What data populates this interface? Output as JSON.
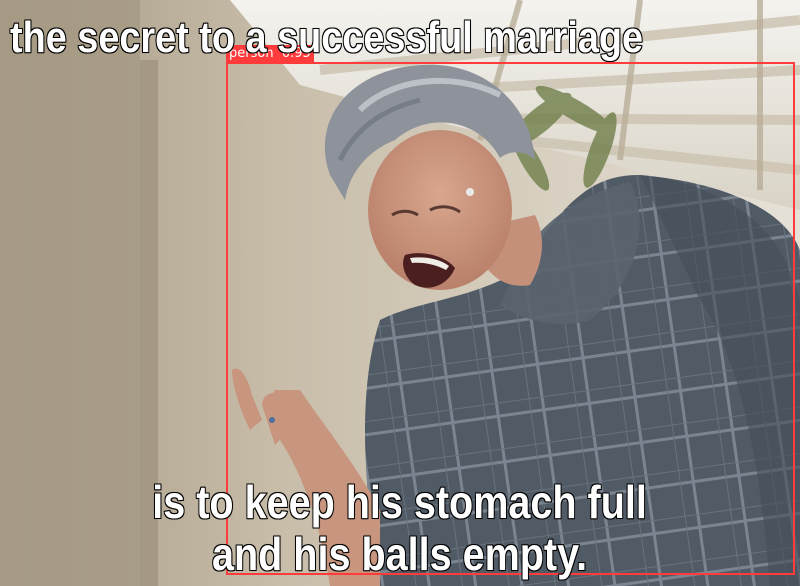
{
  "meme": {
    "top_text": "the secret to a successful marriage",
    "bottom_lines": [
      "is to keep his stomach full",
      "and his balls empty."
    ]
  },
  "detection": {
    "label": "person",
    "score": "0.95",
    "box_color": "#ff3b3b"
  },
  "colors": {
    "caption_fill": "#ffffff",
    "caption_stroke": "#000000",
    "dress": "#4f5862",
    "hair": "#8e939b"
  }
}
